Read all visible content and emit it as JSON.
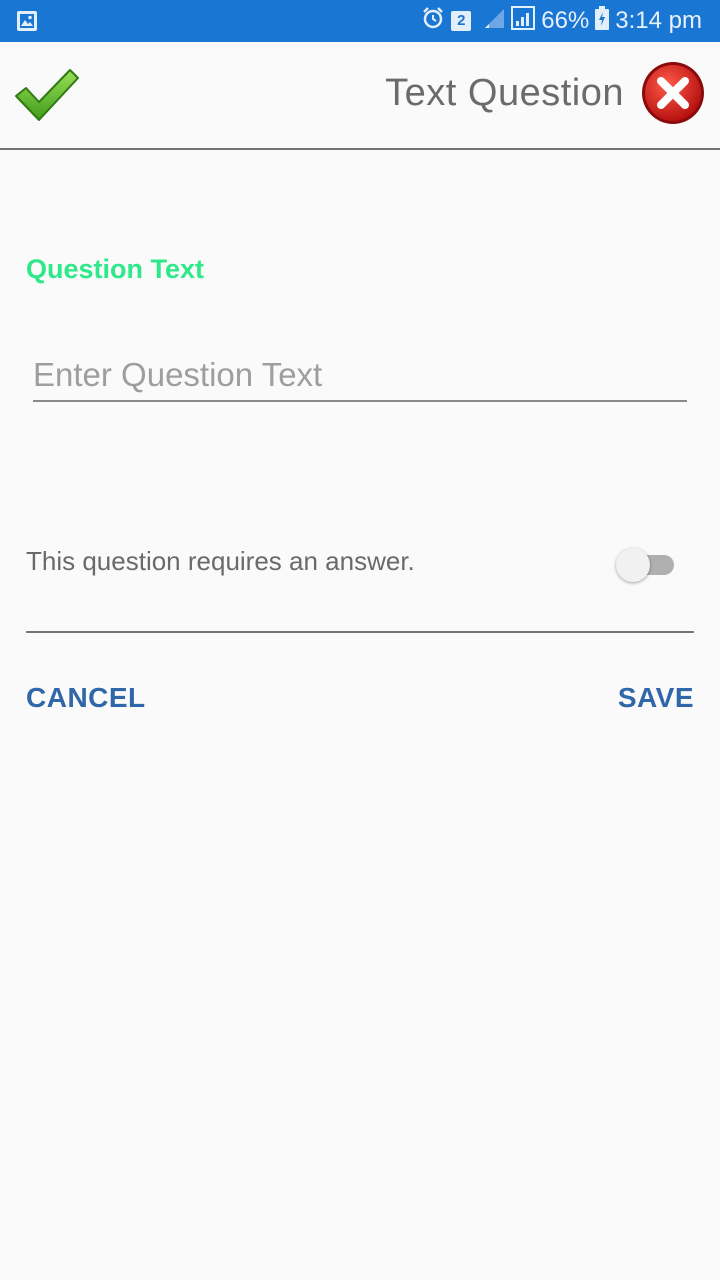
{
  "status_bar": {
    "battery": "66%",
    "time": "3:14 pm",
    "sim_badge": "2",
    "icons": [
      "gallery-icon",
      "alarm-icon",
      "sim-2-icon",
      "signal-icon",
      "signal-icon",
      "battery-charging-icon"
    ]
  },
  "toolbar": {
    "title": "Text Question",
    "confirm_icon": "checkmark-icon",
    "close_icon": "close-icon"
  },
  "form": {
    "question_label": "Question Text",
    "question_placeholder": "Enter Question Text",
    "question_value": "",
    "required_label": "This question requires an answer.",
    "required_toggle_on": false
  },
  "actions": {
    "cancel_label": "CANCEL",
    "save_label": "SAVE"
  },
  "colors": {
    "status_bar": "#1976d2",
    "accent_green": "#2ee88a",
    "button_blue": "#2f67a8",
    "background": "#fafafa"
  }
}
